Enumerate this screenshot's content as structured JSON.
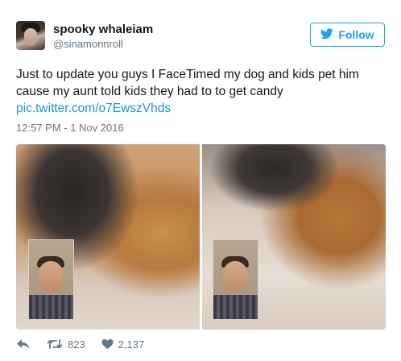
{
  "user": {
    "name": "spooky whaleiam",
    "handle": "@sinamonnroll"
  },
  "follow_button": {
    "label": "Follow"
  },
  "tweet": {
    "text_line1": "Just to update you guys I FaceTimed my dog and kids pet him",
    "text_line2": "cause my aunt told kids they had to to get candy",
    "link": "pic.twitter.com/o7EwszVhds",
    "timestamp": "12:57 PM - 1 Nov 2016"
  },
  "actions": {
    "reply_icon": "reply-arrow-icon",
    "retweet_icon": "retweet-icon",
    "retweet_count": "823",
    "like_icon": "heart-icon",
    "like_count": "2,137"
  },
  "colors": {
    "accent": "#1da1f2",
    "link": "#1b95e0",
    "muted": "#657786",
    "text": "#14171a"
  }
}
